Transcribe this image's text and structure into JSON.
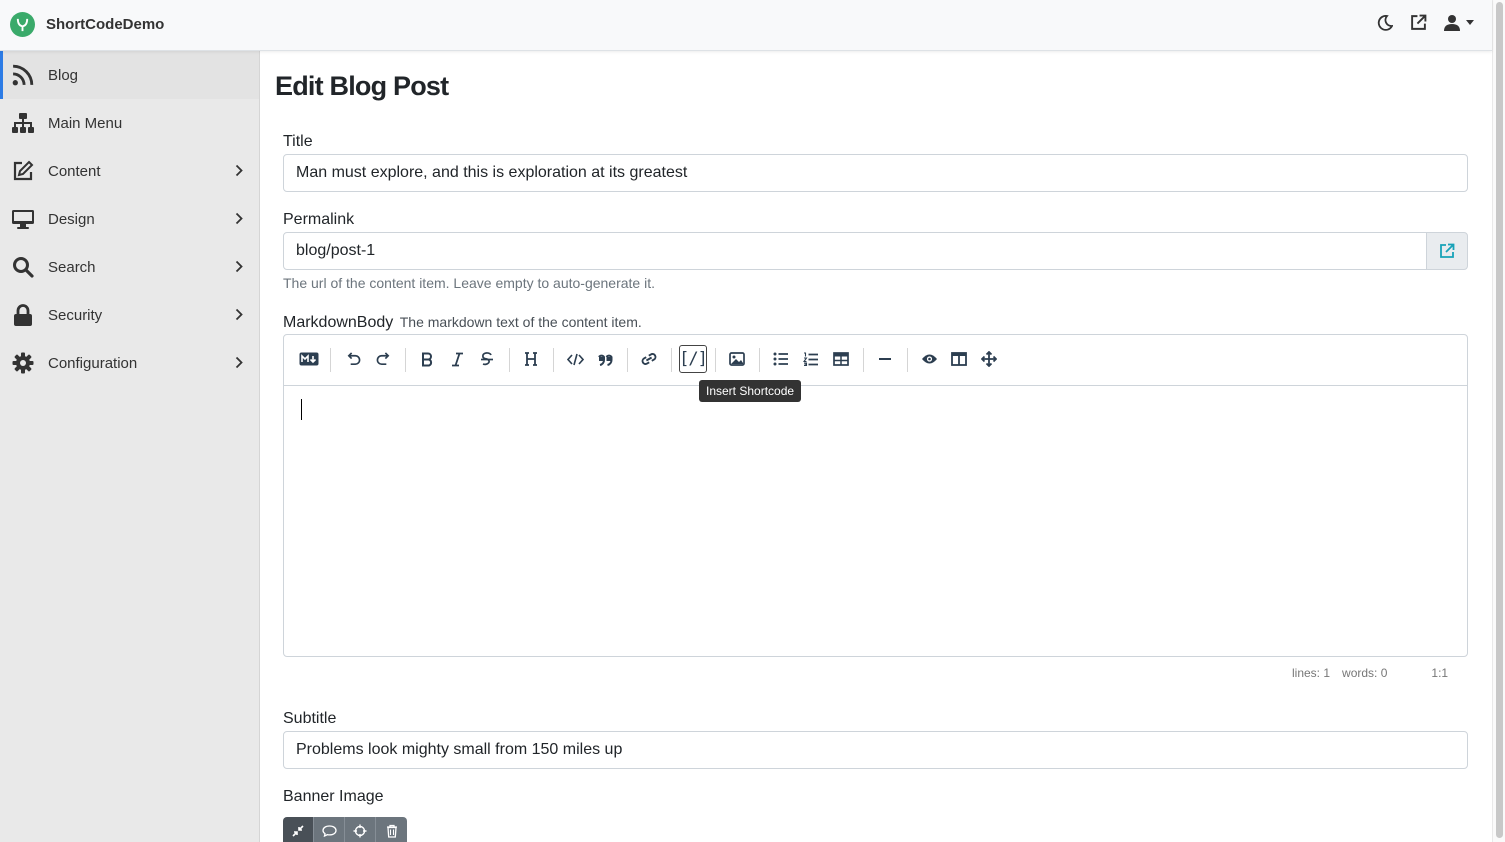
{
  "app": {
    "name": "ShortCodeDemo"
  },
  "topbar": {
    "icons": [
      "moon-icon",
      "external-link-icon",
      "user-icon",
      "caret-down-icon"
    ]
  },
  "sidebar": {
    "items": [
      {
        "label": "Blog",
        "icon": "rss-icon",
        "active": true
      },
      {
        "label": "Main Menu",
        "icon": "sitemap-icon"
      },
      {
        "label": "Content",
        "icon": "edit-icon",
        "expandable": true
      },
      {
        "label": "Design",
        "icon": "desktop-icon",
        "expandable": true
      },
      {
        "label": "Search",
        "icon": "search-icon",
        "expandable": true
      },
      {
        "label": "Security",
        "icon": "lock-icon",
        "expandable": true
      },
      {
        "label": "Configuration",
        "icon": "gear-icon",
        "expandable": true
      }
    ]
  },
  "page": {
    "title": "Edit Blog Post"
  },
  "form": {
    "title": {
      "label": "Title",
      "value": "Man must explore, and this is exploration at its greatest"
    },
    "permalink": {
      "label": "Permalink",
      "value": "blog/post-1",
      "help": "The url of the content item. Leave empty to auto-generate it."
    },
    "markdown_body": {
      "label": "MarkdownBody",
      "hint": "The markdown text of the content item.",
      "tooltip": "Insert Shortcode",
      "shortcode_glyph": "[/]",
      "status": {
        "lines": "lines: 1",
        "words": "words: 0",
        "cursor": "1:1"
      }
    },
    "subtitle": {
      "label": "Subtitle",
      "value": "Problems look mighty small from 150 miles up"
    },
    "banner_image": {
      "label": "Banner Image"
    }
  },
  "colors": {
    "accent": "#2c7be5",
    "logo": "#3aaa6a",
    "link_icon": "#17a2b8"
  }
}
